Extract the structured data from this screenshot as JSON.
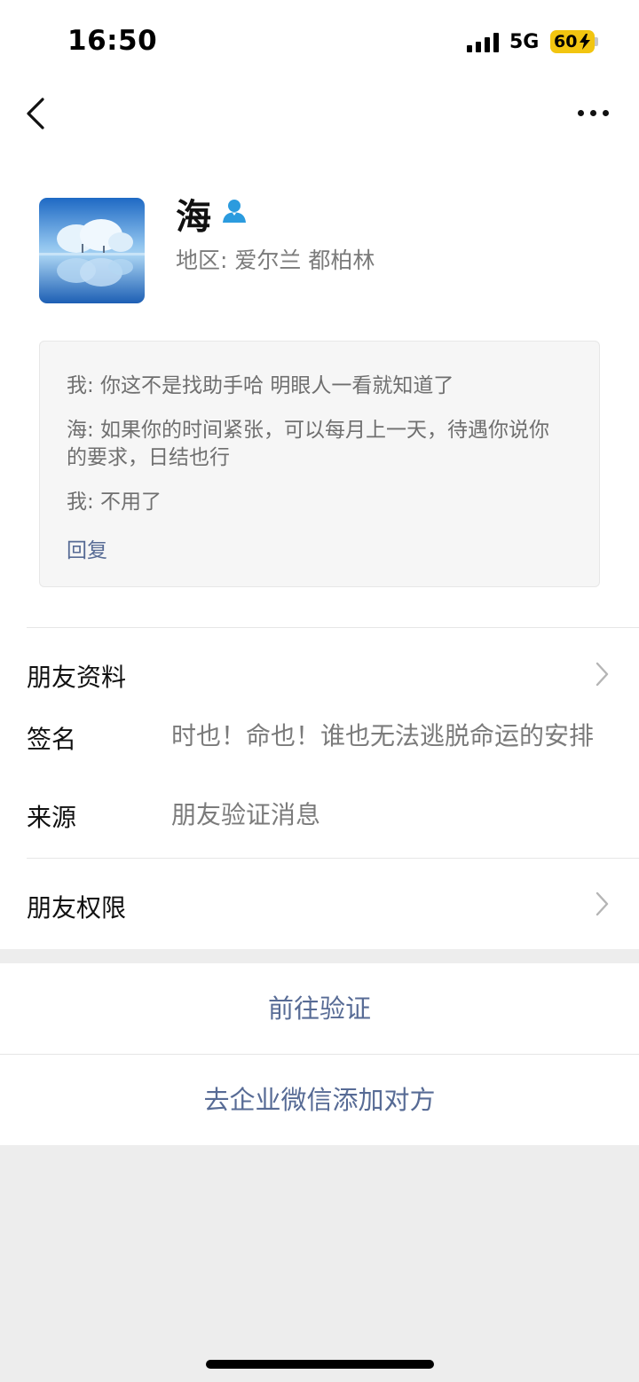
{
  "status_bar": {
    "time": "16:50",
    "network": "5G",
    "battery": "60"
  },
  "profile": {
    "name": "海",
    "region": "地区: 爱尔兰 都柏林"
  },
  "messages": [
    {
      "text": "我: 你这不是找助手哈 明眼人一看就知道了"
    },
    {
      "text": "海: 如果你的时间紧张，可以每月上一天，待遇你说你的要求，日结也行"
    },
    {
      "text": "我: 不用了"
    }
  ],
  "reply_label": "回复",
  "friend_info": {
    "label": "朋友资料",
    "signature_label": "签名",
    "signature_value": "时也！命也！谁也无法逃脱命运的安排",
    "source_label": "来源",
    "source_value": "朋友验证消息"
  },
  "permissions_label": "朋友权限",
  "actions": {
    "verify": "前往验证",
    "enterprise_add": "去企业微信添加对方"
  },
  "colors": {
    "link": "#576b95",
    "battery": "#f2c510",
    "verified_icon": "#2b9bde"
  }
}
